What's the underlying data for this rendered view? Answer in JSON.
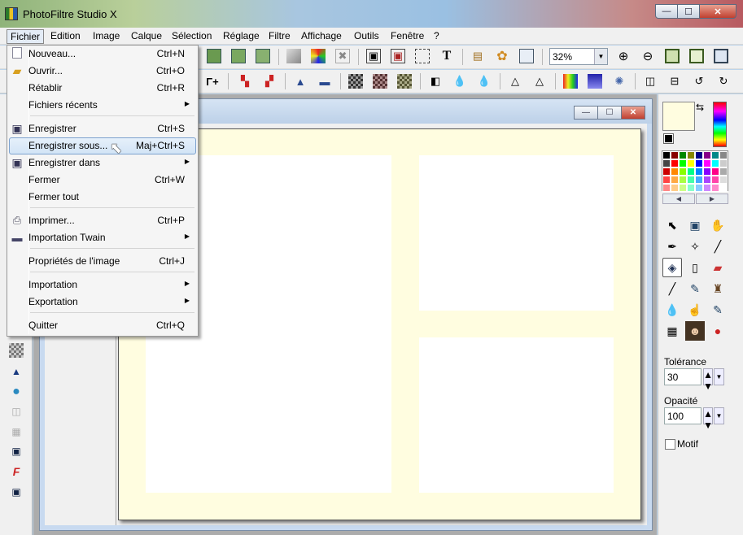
{
  "window": {
    "title": "PhotoFiltre Studio X",
    "minimize_glyph": "—",
    "maximize_glyph": "☐",
    "close_glyph": "✕"
  },
  "menubar": {
    "items": [
      "Fichier",
      "Edition",
      "Image",
      "Calque",
      "Sélection",
      "Réglage",
      "Filtre",
      "Affichage",
      "Outils",
      "Fenêtre",
      "?"
    ],
    "active": "Fichier"
  },
  "toolbar": {
    "zoom_value": "32%",
    "text_tool_glyph": "T",
    "angle_glyph": "Γ+"
  },
  "file_menu": {
    "items": [
      {
        "label": "Nouveau...",
        "shortcut": "Ctrl+N",
        "icon": "new-file-icon"
      },
      {
        "label": "Ouvrir...",
        "shortcut": "Ctrl+O",
        "icon": "open-folder-icon"
      },
      {
        "label": "Rétablir",
        "shortcut": "Ctrl+R",
        "icon": ""
      },
      {
        "label": "Fichiers récents",
        "shortcut": "",
        "icon": "",
        "submenu": true
      },
      {
        "label": "Enregistrer",
        "shortcut": "Ctrl+S",
        "icon": "save-disk-icon"
      },
      {
        "label": "Enregistrer sous...",
        "shortcut": "Maj+Ctrl+S",
        "icon": "",
        "highlighted": true
      },
      {
        "label": "Enregistrer dans",
        "shortcut": "",
        "icon": "save-in-folder-icon",
        "submenu": true
      },
      {
        "label": "Fermer",
        "shortcut": "Ctrl+W",
        "icon": ""
      },
      {
        "label": "Fermer tout",
        "shortcut": "",
        "icon": ""
      },
      {
        "label": "Imprimer...",
        "shortcut": "Ctrl+P",
        "icon": "printer-icon"
      },
      {
        "label": "Importation Twain",
        "shortcut": "",
        "icon": "scanner-icon",
        "submenu": true
      },
      {
        "label": "Propriétés de l'image",
        "shortcut": "Ctrl+J",
        "icon": ""
      },
      {
        "label": "Importation",
        "shortcut": "",
        "icon": "",
        "submenu": true
      },
      {
        "label": "Exportation",
        "shortcut": "",
        "icon": "",
        "submenu": true
      },
      {
        "label": "Quitter",
        "shortcut": "Ctrl+Q",
        "icon": ""
      }
    ],
    "submenu_glyph": "▶"
  },
  "right_panel": {
    "tolerance_label": "Tolérance",
    "tolerance_value": "30",
    "opacity_label": "Opacité",
    "opacity_value": "100",
    "motif_label": "Motif",
    "motif_checked": false,
    "foreground_color": "#fffde0",
    "background_color": "#000000",
    "swap_glyph": "⇆",
    "palette_left_glyph": "◀",
    "palette_right_glyph": "▶",
    "spin_up_glyph": "▲",
    "spin_down_glyph": "▼",
    "dropdown_glyph": "▼"
  },
  "canvas": {
    "background": "#fffde0"
  },
  "cursor_glyph": "⬉"
}
